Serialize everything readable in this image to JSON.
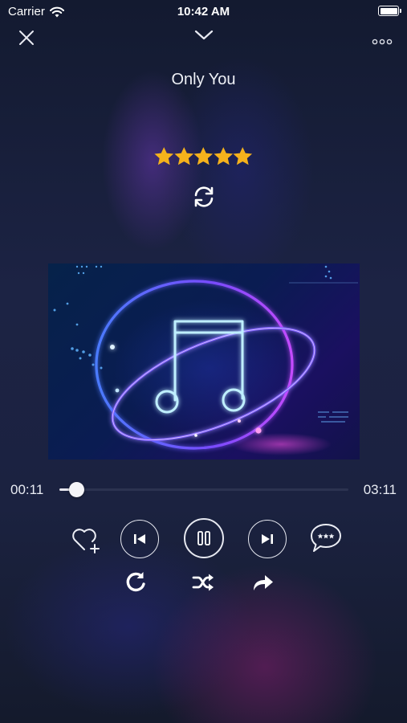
{
  "status_bar": {
    "carrier": "Carrier",
    "time": "10:42 AM",
    "icons": [
      "wifi-icon",
      "battery-icon"
    ]
  },
  "header": {
    "close_icon": "close-icon",
    "collapse_icon": "chevron-down-icon",
    "more_icon": "more-horizontal-icon"
  },
  "song": {
    "title": "Only You",
    "rating": 5,
    "rating_max": 5,
    "sync_icon": "sync-icon",
    "artwork_icon": "music-note-icon"
  },
  "playback": {
    "current_time": "00:11",
    "total_time": "03:11",
    "progress": 0.06
  },
  "controls": {
    "primary": [
      "heart-add-icon",
      "skip-previous-icon",
      "pause-icon",
      "skip-next-icon",
      "comment-icon"
    ],
    "secondary": [
      "repeat-icon",
      "shuffle-icon",
      "share-icon"
    ]
  },
  "colors": {
    "star": "#f5b21c",
    "foreground": "#ffffff",
    "track": "#2c3350",
    "background": "#1c2344"
  }
}
